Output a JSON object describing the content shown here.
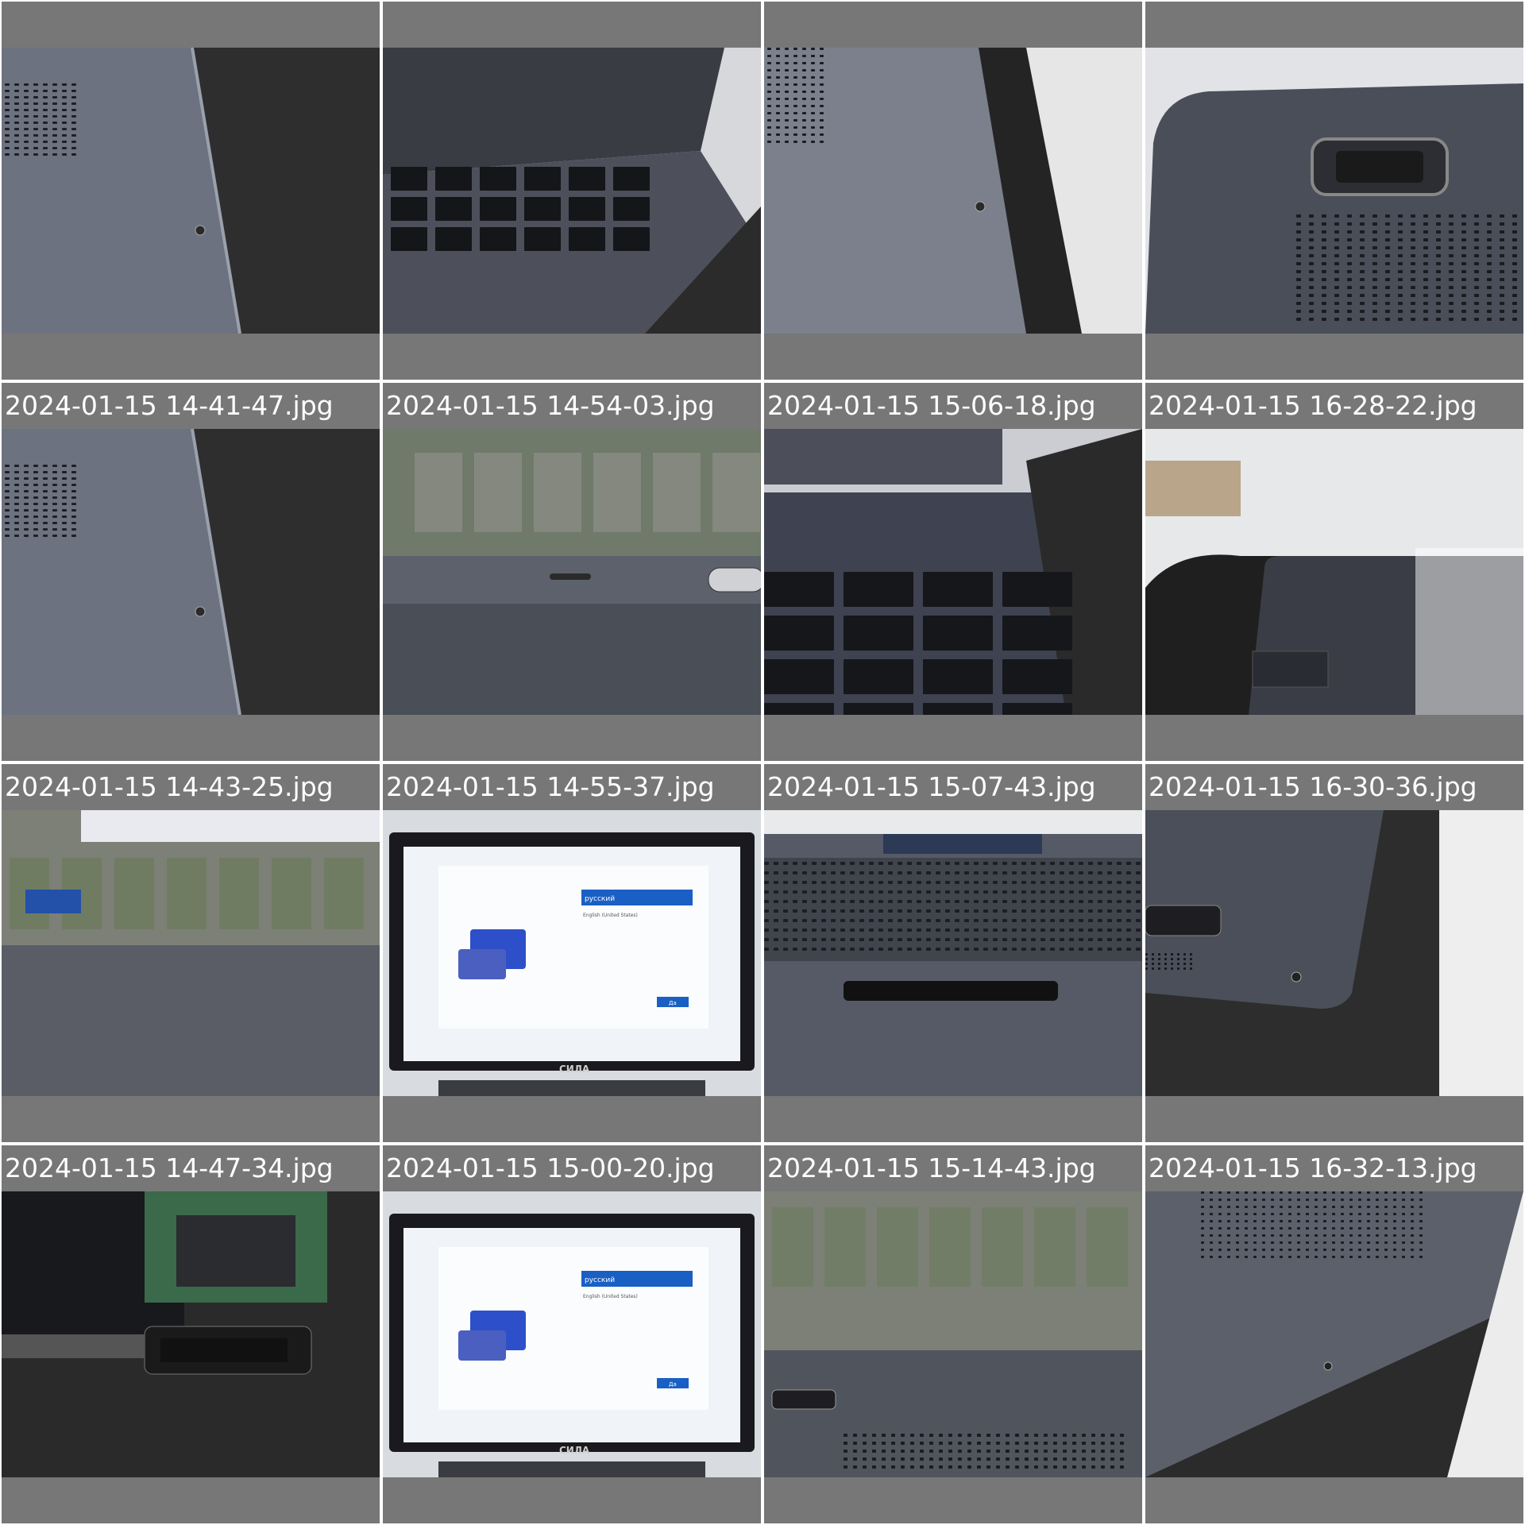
{
  "tiles": [
    {
      "caption": "",
      "subject": "laptop-bottom-vents-on-foam"
    },
    {
      "caption": "",
      "subject": "laptop-keyboard-ports"
    },
    {
      "caption": "",
      "subject": "laptop-bottom-vents-edge"
    },
    {
      "caption": "",
      "subject": "laptop-bottom-speaker"
    },
    {
      "caption": "2024-01-15 14-41-47.jpg",
      "subject": "laptop-bottom-vents-on-foam"
    },
    {
      "caption": "2024-01-15 14-54-03.jpg",
      "subject": "laptop-front-edge"
    },
    {
      "caption": "2024-01-15 15-06-18.jpg",
      "subject": "laptop-keyboard-closeup"
    },
    {
      "caption": "2024-01-15 16-28-22.jpg",
      "subject": "laptop-corner-hand"
    },
    {
      "caption": "2024-01-15 14-43-25.jpg",
      "subject": "laptop-lid-edge"
    },
    {
      "caption": "2024-01-15 14-55-37.jpg",
      "subject": "laptop-setup-screen",
      "screen_texts": {
        "language": "русский",
        "sub": "English (United States)",
        "button": "Да",
        "brand": "СИЛА"
      }
    },
    {
      "caption": "2024-01-15 15-07-43.jpg",
      "subject": "laptop-bottom-open"
    },
    {
      "caption": "2024-01-15 16-30-36.jpg",
      "subject": "laptop-bottom-corner"
    },
    {
      "caption": "2024-01-15 14-47-34.jpg",
      "subject": "laptop-internals-battery"
    },
    {
      "caption": "2024-01-15 15-00-20.jpg",
      "subject": "laptop-setup-screen",
      "screen_texts": {
        "language": "русский",
        "sub": "English (United States)",
        "button": "Да",
        "brand": "СИЛА"
      }
    },
    {
      "caption": "2024-01-15 15-14-43.jpg",
      "subject": "laptop-bottom-lab"
    },
    {
      "caption": "2024-01-15 16-32-13.jpg",
      "subject": "laptop-bottom-vents-diagonal"
    }
  ],
  "colors": {
    "tile_bg": "#777777",
    "caption_text": "#ffffff",
    "metal": "#5f6470",
    "foam": "#2b2b2b",
    "screen_blue": "#1a5fc4"
  }
}
